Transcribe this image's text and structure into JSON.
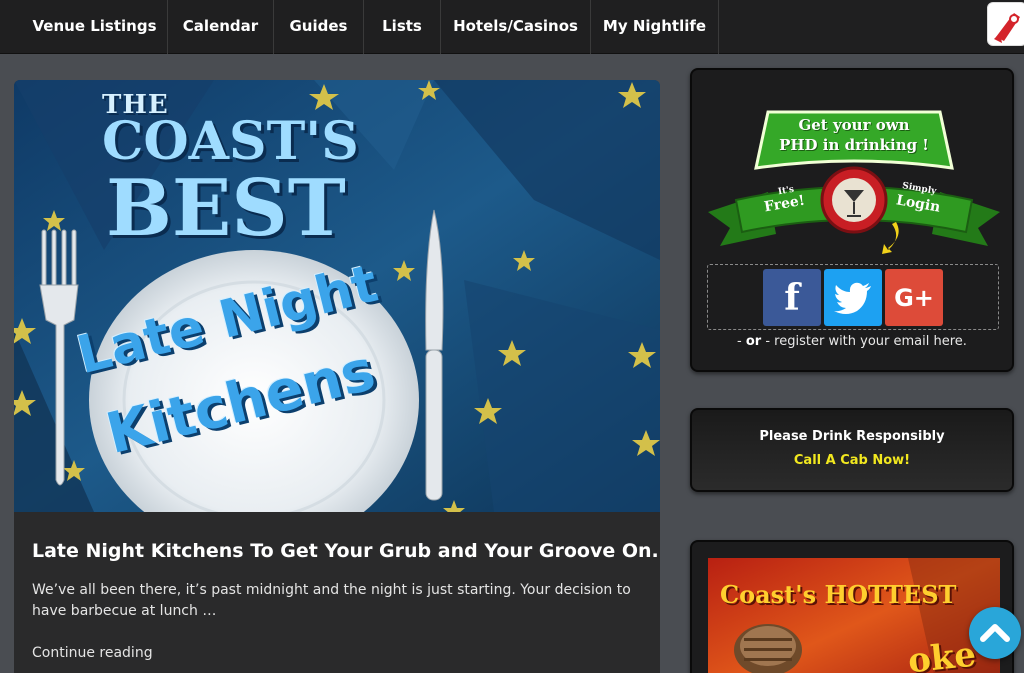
{
  "nav": {
    "items": [
      {
        "label": "Venue Listings"
      },
      {
        "label": "Calendar"
      },
      {
        "label": "Guides"
      },
      {
        "label": "Lists"
      },
      {
        "label": "Hotels/Casinos"
      },
      {
        "label": "My Nightlife"
      }
    ],
    "logo_icon": "rocket-logo-icon"
  },
  "post": {
    "hero": {
      "line1": "THE",
      "line2": "COAST'S",
      "line3": "BEST",
      "plate_line1": "Late Night",
      "plate_line2": "Kitchens"
    },
    "title": "Late Night Kitchens To Get Your Grub and Your Groove On.",
    "excerpt": "We’ve all been there, it’s past midnight and the night is just starting. Your decision to have barbecue at lunch …",
    "continue_label": "Continue reading"
  },
  "login_widget": {
    "banner_line1": "Get your own",
    "banner_line2": "PHD in drinking !",
    "free_label": "It's",
    "free_label2": "Free!",
    "login_label": "Simply",
    "login_label2": "Login",
    "social": [
      {
        "icon": "facebook-icon",
        "glyph": "f",
        "color": "#3b5998"
      },
      {
        "icon": "twitter-icon",
        "glyph": "🐦",
        "color": "#1da1f2"
      },
      {
        "icon": "google-plus-icon",
        "glyph": "G+",
        "color": "#dd4b39"
      }
    ],
    "register_prefix": "- ",
    "register_or": "or",
    "register_suffix": " - register with your email here."
  },
  "drink_widget": {
    "title": "Please Drink Responsibly",
    "cab": "Call A Cab Now!"
  },
  "promo_widget": {
    "text": "Coast's HOTTEST",
    "text2": "oke"
  },
  "colors": {
    "accent_blue": "#29a6d9",
    "cab_yellow": "#f2e81f",
    "banner_green": "#2e8b1e"
  }
}
